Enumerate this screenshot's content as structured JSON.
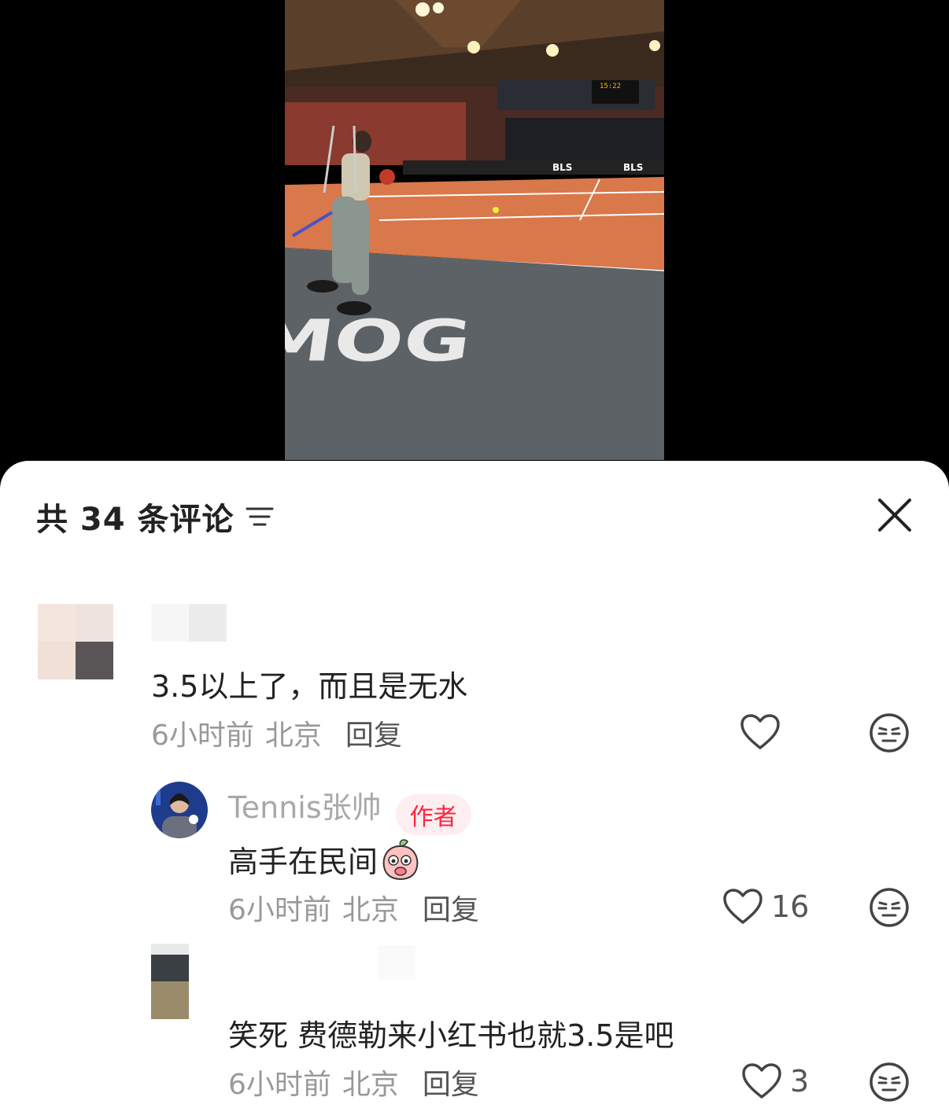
{
  "video": {
    "court_text": "MOG",
    "banner_text": "BLS",
    "clock": "15:22"
  },
  "sheet": {
    "title": "共 34 条评论"
  },
  "comments": [
    {
      "username": "",
      "text": "3.5以上了，而且是无水",
      "time": "6小时前",
      "location": "北京",
      "reply_label": "回复",
      "likes": ""
    },
    {
      "username": "Tennis张帅",
      "badge": "作者",
      "text": "高手在民间",
      "time": "6小时前",
      "location": "北京",
      "reply_label": "回复",
      "likes": "16"
    },
    {
      "username": "",
      "text": "笑死 费德勒来小红书也就3.5是吧",
      "time": "6小时前",
      "location": "北京",
      "reply_label": "回复",
      "likes": "3"
    }
  ],
  "colors": {
    "accent": "#ff2442",
    "court_orange": "#d9784a",
    "court_gray": "#5d6266"
  },
  "icons": [
    "filter-icon",
    "close-icon",
    "heart-icon",
    "emoji-reaction-icon",
    "peach-sticker-icon"
  ]
}
